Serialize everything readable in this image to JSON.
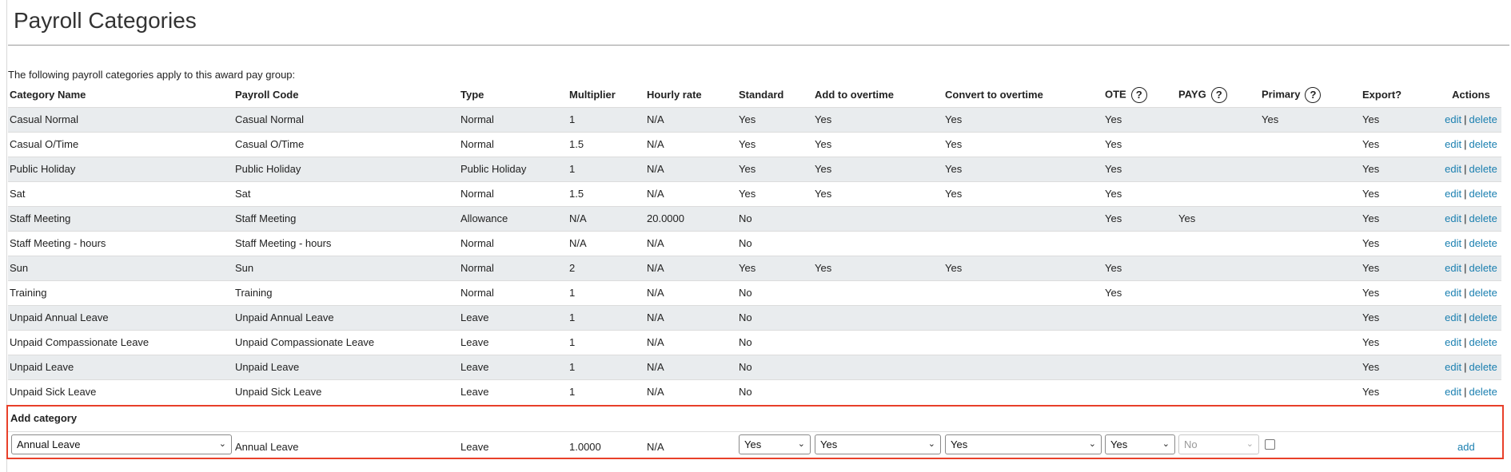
{
  "page": {
    "title": "Payroll Categories",
    "intro": "The following payroll categories apply to this award pay group:"
  },
  "columns": [
    {
      "label": "Category Name",
      "help": false
    },
    {
      "label": "Payroll Code",
      "help": false
    },
    {
      "label": "Type",
      "help": false
    },
    {
      "label": "Multiplier",
      "help": false
    },
    {
      "label": "Hourly rate",
      "help": false
    },
    {
      "label": "Standard",
      "help": false
    },
    {
      "label": "Add to overtime",
      "help": false
    },
    {
      "label": "Convert to overtime",
      "help": false
    },
    {
      "label": "OTE",
      "help": true
    },
    {
      "label": "PAYG",
      "help": true
    },
    {
      "label": "Primary",
      "help": true
    },
    {
      "label": "Export?",
      "help": false
    },
    {
      "label": "Actions",
      "help": false
    }
  ],
  "help_icon_glyph": "?",
  "row_actions": {
    "edit": "edit",
    "separator": "|",
    "delete": "delete"
  },
  "rows": [
    [
      "Casual Normal",
      "Casual Normal",
      "Normal",
      "1",
      "N/A",
      "Yes",
      "Yes",
      "Yes",
      "Yes",
      "",
      "Yes",
      "Yes"
    ],
    [
      "Casual O/Time",
      "Casual O/Time",
      "Normal",
      "1.5",
      "N/A",
      "Yes",
      "Yes",
      "Yes",
      "Yes",
      "",
      "",
      "Yes"
    ],
    [
      "Public Holiday",
      "Public Holiday",
      "Public Holiday",
      "1",
      "N/A",
      "Yes",
      "Yes",
      "Yes",
      "Yes",
      "",
      "",
      "Yes"
    ],
    [
      "Sat",
      "Sat",
      "Normal",
      "1.5",
      "N/A",
      "Yes",
      "Yes",
      "Yes",
      "Yes",
      "",
      "",
      "Yes"
    ],
    [
      "Staff Meeting",
      "Staff Meeting",
      "Allowance",
      "N/A",
      "20.0000",
      "No",
      "",
      "",
      "Yes",
      "Yes",
      "",
      "Yes"
    ],
    [
      "Staff Meeting - hours",
      "Staff Meeting - hours",
      "Normal",
      "N/A",
      "N/A",
      "No",
      "",
      "",
      "",
      "",
      "",
      "Yes"
    ],
    [
      "Sun",
      "Sun",
      "Normal",
      "2",
      "N/A",
      "Yes",
      "Yes",
      "Yes",
      "Yes",
      "",
      "",
      "Yes"
    ],
    [
      "Training",
      "Training",
      "Normal",
      "1",
      "N/A",
      "No",
      "",
      "",
      "Yes",
      "",
      "",
      "Yes"
    ],
    [
      "Unpaid Annual Leave",
      "Unpaid Annual Leave",
      "Leave",
      "1",
      "N/A",
      "No",
      "",
      "",
      "",
      "",
      "",
      "Yes"
    ],
    [
      "Unpaid Compassionate Leave",
      "Unpaid Compassionate Leave",
      "Leave",
      "1",
      "N/A",
      "No",
      "",
      "",
      "",
      "",
      "",
      "Yes"
    ],
    [
      "Unpaid Leave",
      "Unpaid Leave",
      "Leave",
      "1",
      "N/A",
      "No",
      "",
      "",
      "",
      "",
      "",
      "Yes"
    ],
    [
      "Unpaid Sick Leave",
      "Unpaid Sick Leave",
      "Leave",
      "1",
      "N/A",
      "No",
      "",
      "",
      "",
      "",
      "",
      "Yes"
    ]
  ],
  "add_category": {
    "title": "Add category",
    "category_select": "Annual Leave",
    "payroll_code": "Annual Leave",
    "type": "Leave",
    "multiplier": "1.0000",
    "hourly_rate": "N/A",
    "standard_select": "Yes",
    "add_to_overtime_select": "Yes",
    "convert_to_overtime_select": "Yes",
    "ote_select": "Yes",
    "payg_select": "No",
    "primary_checked": false,
    "add_label": "add"
  },
  "colors": {
    "link": "#1a7fb0",
    "row_stripe": "#e9ecee",
    "highlight_border": "#e8402a"
  },
  "icons": {
    "help": "question-circle-icon",
    "dropdown": "chevron-down-icon"
  }
}
